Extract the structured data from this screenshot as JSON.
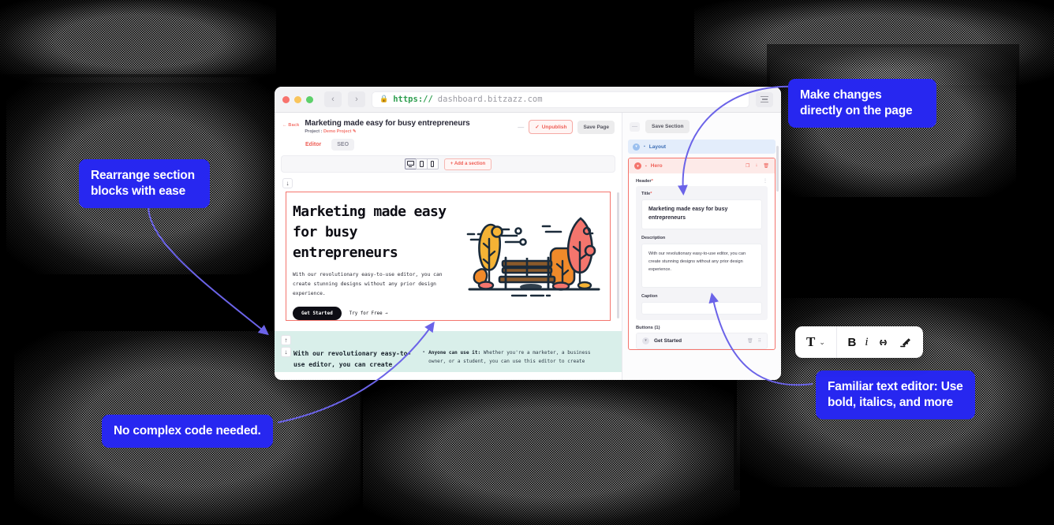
{
  "browser": {
    "url_scheme": "https://",
    "url_host": "dashboard.bitzazz.com",
    "lock_icon": "lock-icon",
    "back_icon": "chevron-left-icon",
    "forward_icon": "chevron-right-icon",
    "menu_icon": "hamburger-menu-icon"
  },
  "app": {
    "back_label": "← Back",
    "page_title": "Marketing made easy for busy entrepreneurs",
    "project_prefix": "Project : ",
    "project_name": "Demo Project",
    "project_edit_icon": "edit-icon",
    "header_actions": {
      "collapse_label": "—",
      "unpublish_label": "Unpublish",
      "unpublish_check": "✓",
      "save_page_label": "Save Page"
    },
    "tabs": [
      {
        "label": "Editor",
        "active": true
      },
      {
        "label": "SEO",
        "active": false
      }
    ],
    "toolbar": {
      "devices": [
        {
          "name": "desktop-view",
          "selected": true
        },
        {
          "name": "tablet-view",
          "selected": false
        },
        {
          "name": "mobile-view",
          "selected": false
        }
      ],
      "add_section_label": "Add a section",
      "add_section_plus": "+"
    },
    "canvas": {
      "move_down_icon": "arrow-down-icon",
      "move_up_icon": "arrow-up-icon",
      "hero": {
        "heading": "Marketing made easy for busy entrepreneurs",
        "description": "With our revolutionary easy-to-use editor, you can create stunning designs without any prior design experience.",
        "cta_label": "Get Started",
        "secondary_label": "Try for Free →",
        "illustration": "autumn-park-bench-illustration"
      },
      "section_two": {
        "heading": "With our revolutionary easy-to-use editor, you can create",
        "bullet_lead": "Anyone can use it:",
        "bullet_text": " Whether you're a marketer, a business owner, or a student, you can use this editor to create"
      }
    }
  },
  "right_panel": {
    "collapse_label": "—",
    "save_section_label": "Save Section",
    "layout_label": "Layout",
    "hero_label": "Hero",
    "hero_icons": [
      "duplicate-icon",
      "move-down-icon",
      "delete-icon"
    ],
    "header_field_label": "Header",
    "header_field_required": "*",
    "kebab_icon": "more-options-icon",
    "title_label": "Title",
    "title_required": "*",
    "title_value": "Marketing made easy for busy entrepreneurs",
    "description_label": "Description",
    "description_value": "With our revolutionary easy-to-use editor, you can create stunning designs without any prior design experience.",
    "caption_label": "Caption",
    "caption_value": "",
    "buttons_label": "Buttons (1)",
    "button_item_label": "Get Started",
    "button_item_icons": [
      "delete-icon",
      "drag-handle-icon"
    ]
  },
  "callouts": {
    "rearrange": "Rearrange section blocks with ease",
    "no_code": "No complex code needed.",
    "make_changes": "Make changes directly on the page",
    "familiar_editor": "Familiar text editor: Use bold, italics, and more"
  },
  "editor_widget": {
    "type_label": "T",
    "chevron": "⌄",
    "bold_label": "B",
    "italic_label": "i",
    "link_icon": "link-icon",
    "highlight_icon": "highlighter-icon"
  },
  "colors": {
    "callout_blue": "#2727f0",
    "accent_red": "#ef5f57",
    "arrow_purple": "#6b63e8",
    "section_mint": "#d9efea"
  }
}
